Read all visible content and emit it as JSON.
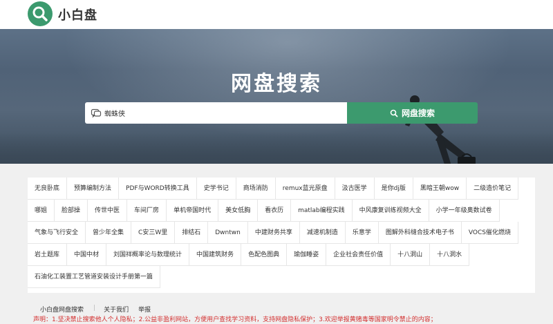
{
  "header": {
    "logo_text": "小白盘",
    "logo_color": "#3c9a6e"
  },
  "hero": {
    "title": "网盘搜索"
  },
  "search": {
    "value": "蜘蛛侠",
    "button_label": "网盘搜索",
    "icon": "search-icon",
    "button_color": "#3c9a6e"
  },
  "tags": [
    "无良卧底",
    "预算编制方法",
    "PDF与WORD转换工具",
    "史学书记",
    "商场消防",
    "remux蓝光原盘",
    "汲古医学",
    "是你dj版",
    "黑暗王朝wow",
    "二级造价笔记",
    "哪姐",
    "脸部操",
    "传世中医",
    "车间厂房",
    "单机帝国时代",
    "美女低胸",
    "看衣历",
    "matlab编程实践",
    "中风康复训练视频大全",
    "小学一年级奥数试卷",
    "气象与飞行安全",
    "曾少年全集",
    "C安三W里",
    "排结石",
    "Dwntwn",
    "中建财务共享",
    "减速机制造",
    "乐意学",
    "图解外科缝合技术电子书",
    "VOCS催化燃烧",
    "岩土题库",
    "中国中材",
    "刘国祥概率论与数理统计",
    "中国建筑财务",
    "色配色图典",
    "瑜伽睡姿",
    "企业社会责任价值",
    "十八洞山",
    "十八洞水",
    "石油化工装置工艺管道安装设计手册第一篇"
  ],
  "footer": {
    "site_name": "小白盘网盘搜索",
    "about": "关于我们",
    "report": "举报",
    "disclaimer": "声明：1.坚决禁止搜索他人个人隐私；2.公益非盈利网站，方便用户查找学习资料，支持网盘隐私保护；3.欢迎举报黄赌毒等国家明令禁止的内容；",
    "disclaimer_color": "#d32f2f"
  }
}
